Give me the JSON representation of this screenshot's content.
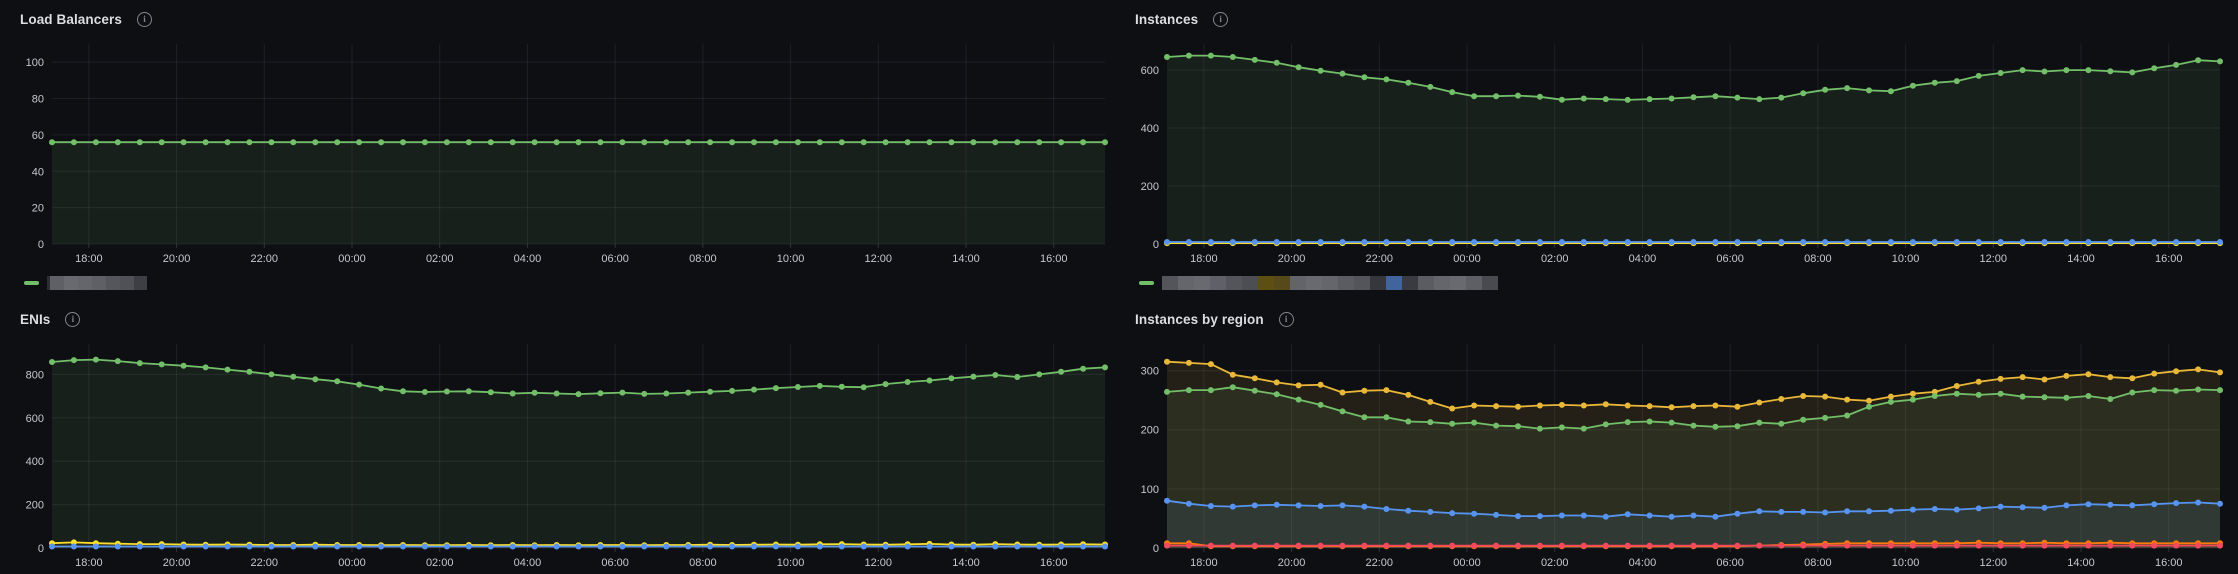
{
  "page": {
    "background": "#0e0f13",
    "grid_color": "rgba(204,204,220,0.09)",
    "axis_text_color": "#c6c7cd"
  },
  "chart_data": [
    {
      "type": "line",
      "title": "Load Balancers",
      "y_ticks": [
        0,
        20,
        40,
        60,
        80,
        100
      ],
      "y_axis_max": 110,
      "x_tick_labels": [
        "18:00",
        "20:00",
        "22:00",
        "00:00",
        "02:00",
        "04:00",
        "06:00",
        "08:00",
        "10:00",
        "12:00",
        "14:00",
        "16:00"
      ],
      "x_first_frac": 0.035,
      "x_step_frac": 0.0833,
      "legend": {
        "visible": true,
        "marker_color": "#73BF69",
        "label_redacted": true,
        "redaction_blocks": [
          {
            "w": 3,
            "c": "#2d2e32"
          },
          {
            "w": 14,
            "c": "#5f6066"
          },
          {
            "w": 14,
            "c": "#696a70"
          },
          {
            "w": 14,
            "c": "#65666c"
          },
          {
            "w": 14,
            "c": "#5f6066"
          },
          {
            "w": 14,
            "c": "#55565c"
          },
          {
            "w": 14,
            "c": "#505157"
          },
          {
            "w": 13,
            "c": "#3e3f44"
          }
        ]
      },
      "series": [
        {
          "name": "redacted",
          "color": "#73BF69",
          "fill_opacity": 0.1,
          "values": [
            56,
            56,
            56,
            56,
            56,
            56,
            56,
            56,
            56,
            56,
            56,
            56,
            56,
            56,
            56,
            56,
            56,
            56,
            56,
            56,
            56,
            56,
            56,
            56,
            56,
            56,
            56,
            56,
            56,
            56,
            56,
            56,
            56,
            56,
            56,
            56,
            56,
            56,
            56,
            56,
            56,
            56,
            56,
            56,
            56,
            56,
            56,
            56,
            56
          ]
        }
      ]
    },
    {
      "type": "line",
      "title": "Instances",
      "y_ticks": [
        0,
        200,
        400,
        600
      ],
      "y_axis_max": 690,
      "x_tick_labels": [
        "18:00",
        "20:00",
        "22:00",
        "00:00",
        "02:00",
        "04:00",
        "06:00",
        "08:00",
        "10:00",
        "12:00",
        "14:00",
        "16:00"
      ],
      "x_first_frac": 0.035,
      "x_step_frac": 0.0833,
      "legend": {
        "visible": true,
        "marker_color": "#73BF69",
        "label_redacted": true,
        "redaction_blocks": [
          {
            "w": 16,
            "c": "#54555a"
          },
          {
            "w": 16,
            "c": "#65666b"
          },
          {
            "w": 16,
            "c": "#696a6f"
          },
          {
            "w": 16,
            "c": "#5f6068"
          },
          {
            "w": 16,
            "c": "#54555a"
          },
          {
            "w": 16,
            "c": "#4d4e53"
          },
          {
            "w": 16,
            "c": "#5d4e12"
          },
          {
            "w": 16,
            "c": "#574a1a"
          },
          {
            "w": 16,
            "c": "#636469"
          },
          {
            "w": 16,
            "c": "#696a6f"
          },
          {
            "w": 16,
            "c": "#65666b"
          },
          {
            "w": 16,
            "c": "#5b5c61"
          },
          {
            "w": 16,
            "c": "#54555a"
          },
          {
            "w": 16,
            "c": "#36373c"
          },
          {
            "w": 16,
            "c": "#41639e"
          },
          {
            "w": 16,
            "c": "#3a3b40"
          },
          {
            "w": 16,
            "c": "#5b5c61"
          },
          {
            "w": 16,
            "c": "#65666b"
          },
          {
            "w": 16,
            "c": "#696a6f"
          },
          {
            "w": 16,
            "c": "#5e5f64"
          },
          {
            "w": 16,
            "c": "#494a4f"
          }
        ]
      },
      "series": [
        {
          "name": "redacted",
          "color": "#73BF69",
          "fill_opacity": 0.1,
          "values": [
            645,
            650,
            650,
            645,
            635,
            625,
            610,
            598,
            588,
            575,
            568,
            556,
            542,
            524,
            510,
            510,
            512,
            508,
            498,
            502,
            500,
            497,
            500,
            502,
            506,
            510,
            505,
            500,
            505,
            520,
            532,
            538,
            530,
            527,
            546,
            556,
            562,
            580,
            590,
            600,
            595,
            600,
            600,
            596,
            592,
            606,
            618,
            634,
            630
          ]
        },
        {
          "name": "redacted",
          "color": "#FADE2A",
          "fill_opacity": 0,
          "values": [
            3,
            3,
            3,
            3,
            3,
            3,
            3,
            3,
            3,
            3,
            3,
            3,
            3,
            3,
            3,
            3,
            3,
            3,
            3,
            3,
            3,
            3,
            3,
            3,
            3,
            3,
            3,
            3,
            3,
            3,
            3,
            3,
            3,
            3,
            3,
            3,
            3,
            3,
            3,
            3,
            3,
            3,
            3,
            3,
            3,
            3,
            3,
            3,
            3
          ]
        },
        {
          "name": "redacted",
          "color": "#5794F2",
          "fill_opacity": 0,
          "values": [
            7,
            7,
            7,
            7,
            7,
            7,
            7,
            7,
            7,
            7,
            7,
            7,
            7,
            7,
            7,
            7,
            7,
            7,
            7,
            7,
            7,
            7,
            7,
            7,
            7,
            7,
            7,
            7,
            7,
            7,
            7,
            7,
            7,
            7,
            7,
            7,
            7,
            7,
            7,
            7,
            7,
            7,
            7,
            7,
            7,
            7,
            7,
            7,
            7
          ]
        }
      ]
    },
    {
      "type": "line",
      "title": "ENIs",
      "y_ticks": [
        0,
        200,
        400,
        600,
        800
      ],
      "y_axis_max": 940,
      "x_tick_labels": [
        "18:00",
        "20:00",
        "22:00",
        "00:00",
        "02:00",
        "04:00",
        "06:00",
        "08:00",
        "10:00",
        "12:00",
        "14:00",
        "16:00"
      ],
      "x_first_frac": 0.035,
      "x_step_frac": 0.0833,
      "legend": {
        "visible": false
      },
      "series": [
        {
          "name": "redacted",
          "color": "#73BF69",
          "fill_opacity": 0.1,
          "values": [
            857,
            866,
            868,
            861,
            852,
            846,
            840,
            832,
            822,
            812,
            800,
            789,
            778,
            768,
            753,
            735,
            722,
            719,
            721,
            722,
            718,
            712,
            715,
            712,
            709,
            713,
            716,
            710,
            712,
            716,
            720,
            724,
            730,
            737,
            742,
            747,
            743,
            741,
            755,
            765,
            772,
            782,
            790,
            797,
            788,
            800,
            812,
            826,
            832
          ]
        },
        {
          "name": "redacted",
          "color": "#FADE2A",
          "fill_opacity": 0.05,
          "values": [
            22,
            26,
            22,
            20,
            18,
            18,
            16,
            15,
            16,
            15,
            14,
            14,
            15,
            14,
            14,
            13,
            14,
            13,
            13,
            14,
            13,
            14,
            13,
            14,
            13,
            14,
            14,
            13,
            14,
            14,
            15,
            14,
            15,
            16,
            15,
            17,
            18,
            16,
            15,
            17,
            19,
            16,
            15,
            18,
            16,
            15,
            16,
            17,
            16
          ]
        },
        {
          "name": "redacted",
          "color": "#5794F2",
          "fill_opacity": 0,
          "values": [
            7,
            7,
            7,
            7,
            7,
            7,
            7,
            7,
            7,
            7,
            7,
            7,
            7,
            7,
            7,
            7,
            7,
            7,
            7,
            7,
            7,
            7,
            7,
            7,
            7,
            7,
            7,
            7,
            7,
            7,
            7,
            7,
            7,
            7,
            7,
            7,
            7,
            7,
            7,
            7,
            7,
            7,
            7,
            7,
            7,
            7,
            7,
            7,
            7
          ]
        }
      ]
    },
    {
      "type": "line",
      "title": "Instances by region",
      "y_ticks": [
        0,
        100,
        200,
        300
      ],
      "y_axis_max": 345,
      "x_tick_labels": [
        "18:00",
        "20:00",
        "22:00",
        "00:00",
        "02:00",
        "04:00",
        "06:00",
        "08:00",
        "10:00",
        "12:00",
        "14:00",
        "16:00"
      ],
      "x_first_frac": 0.035,
      "x_step_frac": 0.0833,
      "legend": {
        "visible": false
      },
      "series": [
        {
          "name": "redacted",
          "color": "#EAB839",
          "fill_opacity": 0.1,
          "values": [
            315,
            313,
            311,
            293,
            287,
            280,
            275,
            276,
            263,
            266,
            267,
            259,
            247,
            236,
            241,
            240,
            239,
            241,
            242,
            241,
            243,
            241,
            240,
            238,
            240,
            241,
            239,
            246,
            252,
            257,
            256,
            251,
            249,
            256,
            261,
            264,
            274,
            281,
            286,
            289,
            285,
            291,
            294,
            289,
            287,
            295,
            299,
            302,
            297
          ]
        },
        {
          "name": "redacted",
          "color": "#73BF69",
          "fill_opacity": 0.1,
          "values": [
            264,
            267,
            267,
            272,
            266,
            260,
            251,
            242,
            231,
            221,
            221,
            214,
            213,
            210,
            212,
            207,
            206,
            202,
            204,
            202,
            209,
            213,
            214,
            212,
            207,
            205,
            206,
            212,
            210,
            217,
            220,
            224,
            239,
            247,
            251,
            257,
            261,
            259,
            261,
            256,
            255,
            254,
            257,
            252,
            263,
            267,
            266,
            268,
            267
          ]
        },
        {
          "name": "redacted",
          "color": "#5794F2",
          "fill_opacity": 0.1,
          "values": [
            80,
            75,
            71,
            70,
            72,
            73,
            72,
            71,
            72,
            70,
            66,
            63,
            61,
            59,
            58,
            56,
            54,
            54,
            55,
            55,
            53,
            57,
            55,
            53,
            55,
            53,
            58,
            62,
            61,
            61,
            60,
            62,
            62,
            63,
            65,
            66,
            65,
            67,
            70,
            69,
            68,
            72,
            74,
            73,
            72,
            74,
            76,
            77,
            75
          ]
        },
        {
          "name": "redacted",
          "color": "#FF780A",
          "fill_opacity": 0.05,
          "values": [
            8,
            8,
            3,
            3,
            3,
            3,
            3,
            3,
            3,
            3,
            3,
            3,
            3,
            3,
            3,
            3,
            3,
            3,
            3,
            3,
            3,
            3,
            3,
            3,
            3,
            3,
            3,
            4,
            5,
            6,
            7,
            8,
            8,
            8,
            8,
            8,
            8,
            9,
            8,
            8,
            9,
            8,
            8,
            9,
            8,
            8,
            8,
            8,
            8
          ]
        },
        {
          "name": "redacted",
          "color": "#F2495C",
          "fill_opacity": 0.05,
          "values": [
            4,
            4,
            4,
            4,
            4,
            4,
            4,
            4,
            4,
            4,
            4,
            4,
            4,
            4,
            4,
            4,
            4,
            4,
            4,
            4,
            4,
            4,
            4,
            4,
            4,
            4,
            4,
            4,
            4,
            4,
            4,
            4,
            4,
            4,
            4,
            4,
            4,
            4,
            4,
            4,
            4,
            4,
            4,
            4,
            4,
            4,
            4,
            4,
            4
          ]
        }
      ]
    }
  ]
}
